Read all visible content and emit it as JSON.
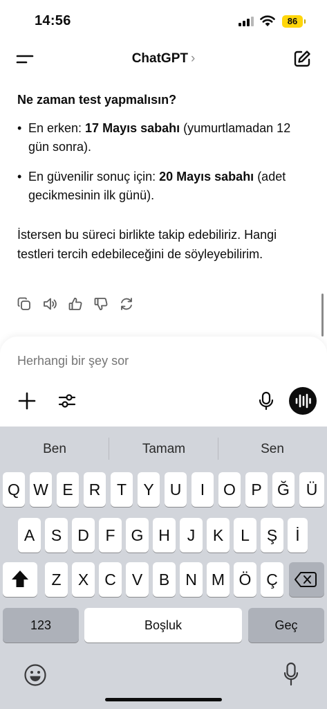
{
  "status_bar": {
    "time": "14:56",
    "battery_level": "86",
    "battery_color": "#ffd60a",
    "icons": [
      "signal-icon",
      "wifi-icon",
      "battery-icon"
    ]
  },
  "nav": {
    "title": "ChatGPT",
    "chevron": "›",
    "icons": [
      "menu-icon",
      "compose-icon"
    ]
  },
  "message": {
    "heading": "Ne zaman test yapmalısın?",
    "bullets": [
      {
        "bullet": "•",
        "prefix": "En erken: ",
        "bold": "17 Mayıs sabahı",
        "suffix": " (yumurtlamadan 12 gün sonra)."
      },
      {
        "bullet": "•",
        "prefix": "En güvenilir sonuç için: ",
        "bold": "20 Mayıs sabahı",
        "suffix": " (adet gecikmesinin ilk günü)."
      }
    ],
    "paragraph": "İstersen bu süreci birlikte takip edebiliriz. Hangi testleri tercih edebileceğini de söyleyebilirim.",
    "action_icons": [
      "copy-icon",
      "read-aloud-icon",
      "thumbs-up-icon",
      "thumbs-down-icon",
      "regenerate-icon"
    ]
  },
  "composer": {
    "placeholder": "Herhangi bir şey sor",
    "icons": [
      "plus-icon",
      "tools-icon",
      "mic-icon",
      "voice-mode-icon"
    ]
  },
  "keyboard": {
    "suggestions": [
      "Ben",
      "Tamam",
      "Sen"
    ],
    "row1": [
      "Q",
      "W",
      "E",
      "R",
      "T",
      "Y",
      "U",
      "I",
      "O",
      "P",
      "Ğ",
      "Ü"
    ],
    "row2": [
      "A",
      "S",
      "D",
      "F",
      "G",
      "H",
      "J",
      "K",
      "L",
      "Ş",
      "İ"
    ],
    "row3": [
      "Z",
      "X",
      "C",
      "V",
      "B",
      "N",
      "M",
      "Ö",
      "Ç"
    ],
    "shift_icon": "shift-icon",
    "delete_icon": "delete-icon",
    "numbers_key": "123",
    "space_key": "Boşluk",
    "return_key": "Geç",
    "bottom_icons": [
      "emoji-icon",
      "dictation-mic-icon"
    ]
  }
}
